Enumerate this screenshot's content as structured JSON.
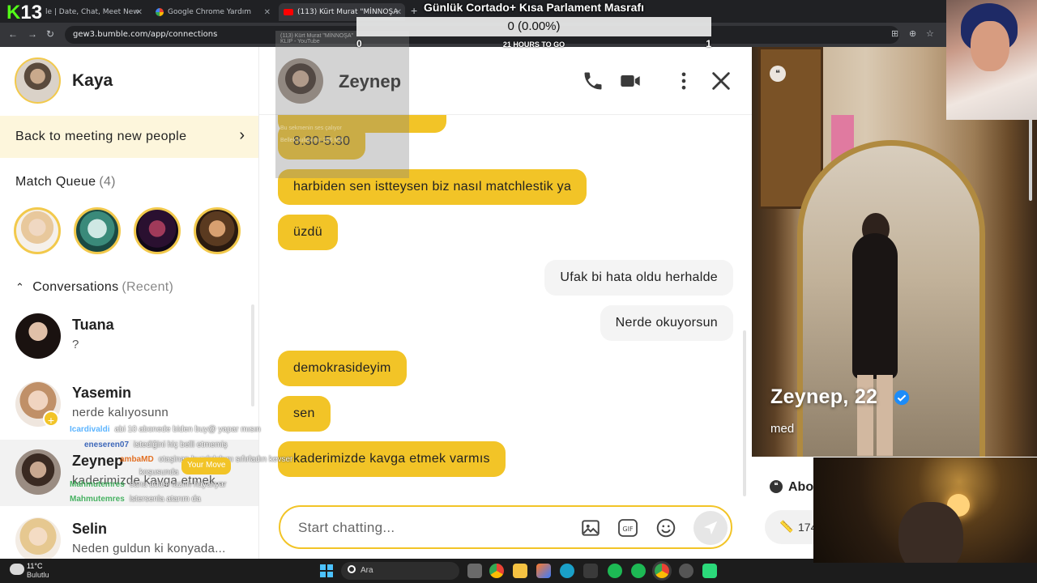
{
  "browser": {
    "tabs": [
      {
        "title": "le | Date, Chat, Meet New"
      },
      {
        "title": "Google Chrome Yardım"
      },
      {
        "title": "(113) Kürt Murat \"MİNNOŞA"
      }
    ],
    "url": "gew3.bumble.com/app/connections",
    "logo": "13"
  },
  "poll": {
    "title": "Günlük Cortado+ Kısa Parlament Masrafı",
    "value": "0 (0.00%)",
    "left_count": "0",
    "right_count": "1",
    "timer": "21 HOURS TO GO"
  },
  "ghost": {
    "line1": "(113) Kürt Murat \"MİNNOŞA\"",
    "line2": "KLİP - YouTube",
    "line3": "Bu sekmenin ses çalıyor",
    "line4": "Bellek kullanımı: 266 MB"
  },
  "sidebar": {
    "me_name": "Kaya",
    "back_label": "Back to meeting new people",
    "match_queue_label": "Match Queue",
    "match_queue_count": "(4)",
    "conversations_label": "Conversations",
    "conversations_sub": "(Recent)",
    "conversations": [
      {
        "name": "Tuana",
        "message": "?"
      },
      {
        "name": "Yasemin",
        "message": "nerde kalıyosunn"
      },
      {
        "name": "Zeynep",
        "message": "kaderimizde kavga etmek..."
      },
      {
        "name": "Selin",
        "message": "Neden guldun ki konyada..."
      }
    ]
  },
  "stream_chat": {
    "badge": "Your Move",
    "lines": [
      {
        "user": "Icardivaldi",
        "color": "#3fa8ff",
        "message": "abi 10 abonede biden buy@ yapar mısın"
      },
      {
        "user": "eneseren07",
        "color": "#1e4fb0",
        "message": "istediğini hiç belli etmemiş"
      },
      {
        "user": "ambaMD",
        "color": "#e05a00",
        "message": "otaşinan buzdolabını sıfırladın kevser"
      },
      {
        "user": "",
        "color": "#ffffff",
        "message": "koşusunda"
      },
      {
        "user": "Mahmutemres",
        "color": "#2aa84a",
        "message": "sana adam lazım hayalıyar"
      },
      {
        "user": "Mahmutemres",
        "color": "#2aa84a",
        "message": "istersenla atarım da"
      }
    ]
  },
  "chat": {
    "name": "Zeynep",
    "messages": [
      {
        "side": "in",
        "text": "8.30-5.30"
      },
      {
        "side": "in",
        "text": "harbiden sen istteysen biz nasıl matchlestik ya"
      },
      {
        "side": "in",
        "text": "üzdü"
      },
      {
        "side": "out",
        "text": "Ufak bi hata oldu herhalde"
      },
      {
        "side": "out",
        "text": "Nerde okuyorsun"
      },
      {
        "side": "in",
        "text": "demokrasideyim"
      },
      {
        "side": "in",
        "text": "sen"
      },
      {
        "side": "in",
        "text": "kaderimizde kavga etmek varmıs"
      }
    ],
    "composer_placeholder": "Start chatting...",
    "gif_label": "GIF"
  },
  "profile": {
    "name": "Zeynep, 22",
    "job": "med",
    "about_label": "Abo",
    "height": "174"
  },
  "taskbar": {
    "weather_temp": "11°C",
    "weather_desc": "Bulutlu",
    "search_text": "Ara"
  },
  "colors": {
    "bumble_yellow": "#f2c427",
    "chrome_dark": "#202124"
  }
}
